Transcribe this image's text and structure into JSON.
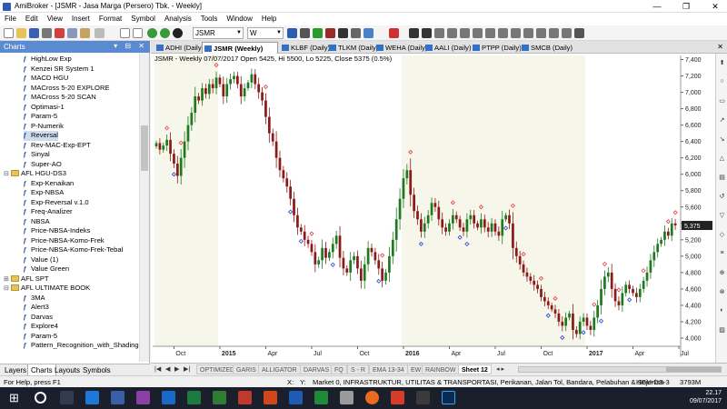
{
  "window": {
    "title": "AmiBroker - [JSMR - Jasa Marga (Persero) Tbk. - Weekly]",
    "buttons": [
      "—",
      "❐",
      "✕"
    ]
  },
  "menu": [
    "File",
    "Edit",
    "View",
    "Insert",
    "Format",
    "Symbol",
    "Analysis",
    "Tools",
    "Window",
    "Help"
  ],
  "toolbar": {
    "symbol_value": "JSMR",
    "interval_value": "W"
  },
  "left_panel": {
    "title": "Charts",
    "tree": [
      {
        "label": "HighLow Exp",
        "type": "f"
      },
      {
        "label": "Kenzei SR System 1",
        "type": "f"
      },
      {
        "label": "MACD HGU",
        "type": "f"
      },
      {
        "label": "MACross 5-20 EXPLORE",
        "type": "f"
      },
      {
        "label": "MACross 5-20 SCAN",
        "type": "f"
      },
      {
        "label": "Optimasi-1",
        "type": "f"
      },
      {
        "label": "Param-5",
        "type": "f"
      },
      {
        "label": "P-Numerik",
        "type": "f"
      },
      {
        "label": "Reversal",
        "type": "f",
        "selected": true
      },
      {
        "label": "Rev-MAC-Exp-EPT",
        "type": "f"
      },
      {
        "label": "Sinyal",
        "type": "f"
      },
      {
        "label": "Super-AO",
        "type": "f"
      },
      {
        "label": "AFL HGU-DS3",
        "type": "folder",
        "open": true
      },
      {
        "label": "Exp-Kenaikan",
        "type": "f"
      },
      {
        "label": "Exp-NBSA",
        "type": "f"
      },
      {
        "label": "Exp-Reversal v.1.0",
        "type": "f"
      },
      {
        "label": "Freq-Analizer",
        "type": "f"
      },
      {
        "label": "NBSA",
        "type": "f"
      },
      {
        "label": "Price-NBSA-Indeks",
        "type": "f"
      },
      {
        "label": "Price-NBSA-Komo-Frek",
        "type": "f"
      },
      {
        "label": "Price-NBSA-Komo-Frek-Tebal",
        "type": "f"
      },
      {
        "label": "Value (1)",
        "type": "f"
      },
      {
        "label": "Value Green",
        "type": "f"
      },
      {
        "label": "AFL SPT",
        "type": "folder",
        "open": false
      },
      {
        "label": "AFL ULTIMATE BOOK",
        "type": "folder",
        "open": true
      },
      {
        "label": "3MA",
        "type": "f"
      },
      {
        "label": "Alert3",
        "type": "f"
      },
      {
        "label": "Darvas",
        "type": "f"
      },
      {
        "label": "Explore4",
        "type": "f"
      },
      {
        "label": "Param-5",
        "type": "f"
      },
      {
        "label": "Pattern_Recognition_with_Shading",
        "type": "f"
      }
    ],
    "tabs": [
      "Layers",
      "Charts",
      "Layouts",
      "Symbols"
    ],
    "active_tab": "Charts"
  },
  "chart_tabs": [
    "ADHI (Daily)",
    "JSMR (Weekly)",
    "KLBF (Daily)",
    "TLKM (Daily)",
    "WEHA (Daily)",
    "AALI (Daily)",
    "PTPP (Daily)",
    "SMCB (Daily)"
  ],
  "active_chart_tab": "JSMR (Weekly)",
  "chart": {
    "header": "JSMR - Weekly 07/07/2017 Open 5425, Hi 5500, Lo 5225, Close 5375 (0.5%)",
    "last_price_label": "5,375"
  },
  "chart_data": {
    "type": "candlestick",
    "title": "JSMR - Weekly 07/07/2017 Open 5425, Hi 5500, Lo 5225, Close 5375 (0.5%)",
    "y_ticks": [
      "7,400",
      "7,200",
      "7,000",
      "6,800",
      "6,600",
      "6,400",
      "6,200",
      "6,000",
      "5,800",
      "5,600",
      "5,400",
      "5,200",
      "5,000",
      "4,800",
      "4,600",
      "4,400",
      "4,200",
      "4,000"
    ],
    "ylim": [
      3900,
      7450
    ],
    "x_ticks": [
      "Oct",
      "2015",
      "Apr",
      "Jul",
      "Oct",
      "2016",
      "Apr",
      "Jul",
      "Oct",
      "2017",
      "Apr",
      "Jul"
    ],
    "x_tick_weeks": [
      5,
      18,
      31,
      44,
      57,
      70,
      83,
      96,
      109,
      122,
      135,
      148
    ],
    "up_color": "#1f7a1f",
    "down_color": "#8b1a1a",
    "signal_top_color": "#e23b3b",
    "signal_bottom_color": "#2b3bd6",
    "closes": [
      6380,
      6300,
      6350,
      6420,
      6250,
      6130,
      5980,
      6200,
      6400,
      6600,
      6750,
      6950,
      6900,
      7050,
      6980,
      7100,
      7050,
      7180,
      7100,
      6950,
      7100,
      7160,
      7200,
      7100,
      6950,
      7050,
      7120,
      7220,
      7100,
      7000,
      6900,
      6700,
      6500,
      6400,
      6200,
      6050,
      5950,
      5850,
      5700,
      5500,
      5350,
      5300,
      5200,
      5150,
      5050,
      4900,
      4950,
      5100,
      4980,
      5050,
      5150,
      5250,
      4980,
      4850,
      4800,
      4950,
      5000,
      4850,
      4700,
      4900,
      5100,
      5050,
      4950,
      4850,
      4700,
      4800,
      5000,
      5200,
      5450,
      5700,
      5950,
      6050,
      5750,
      5550,
      5450,
      5300,
      5400,
      5500,
      5650,
      5600,
      5450,
      5350,
      5300,
      5400,
      5500,
      5450,
      5350,
      5300,
      5450,
      5500,
      5400,
      5350,
      5450,
      5350,
      5300,
      5400,
      5300,
      5250,
      5450,
      5500,
      5400,
      5100,
      5000,
      4900,
      4800,
      4750,
      4700,
      4650,
      4600,
      4500,
      4450,
      4400,
      4350,
      4300,
      4200,
      4150,
      4250,
      4300,
      4100,
      4050,
      4200,
      4250,
      4150,
      4100,
      4250,
      4400,
      4600,
      4750,
      4800,
      4600,
      4450,
      4400,
      4550,
      4650,
      4600,
      4550,
      4500,
      4600,
      4700,
      4800,
      4950,
      5050,
      5150,
      5200,
      5300,
      5250,
      5400,
      5375
    ],
    "top_signal_weeks": [
      3,
      7,
      17,
      31,
      44,
      64,
      72,
      84,
      92,
      101,
      104,
      109,
      113,
      124,
      127,
      131,
      138,
      145,
      147
    ],
    "bottom_signal_weeks": [
      5,
      38,
      41,
      50,
      63,
      75,
      86,
      88,
      99,
      111,
      115,
      121,
      126,
      134
    ],
    "x_ticks_note": "week index of each tick label"
  },
  "sheet_tabs": [
    "OPTIMIZED",
    "GARIS",
    "ALLIGATOR",
    "DARVAS",
    "FQ",
    "S - R",
    "EMA 13-34",
    "EW",
    "RAINBOW",
    "Sheet 12"
  ],
  "active_sheet": "Sheet 12",
  "status": {
    "help": "For Help, press F1",
    "x_label": "X:",
    "y_label": "Y:",
    "market": "Market 0, INFRASTRUKTUR, UTILITAS & TRANSPORTASI, Perikanan, Jalan Tol, Bandara, Pelabuhan & Sejenisn",
    "layout": "HGU-DS-3",
    "memory": "3793M"
  },
  "clock": {
    "time": "22.17",
    "date": "09/07/2017"
  }
}
